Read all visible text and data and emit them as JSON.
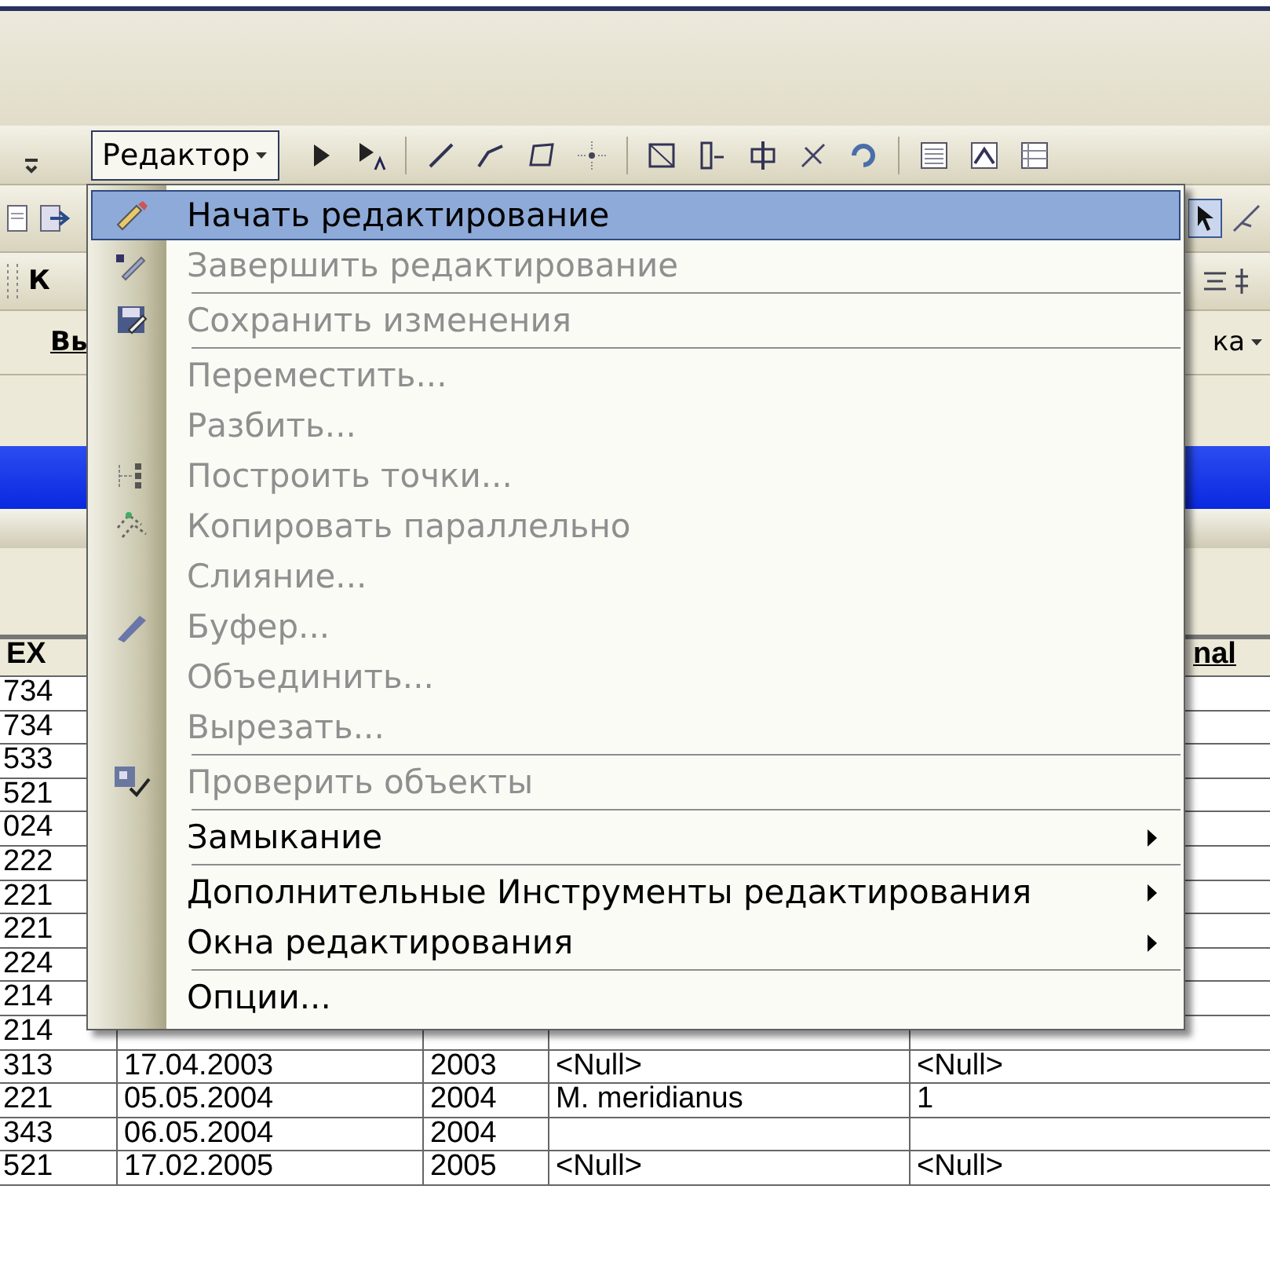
{
  "editor_toolbar": {
    "label": "Редактор"
  },
  "left_toolbar_fragments": [
    "К",
    "Вь"
  ],
  "right_toolbar_fragment": "ка",
  "table": {
    "header_left": "EX",
    "header_right": "nal",
    "rows": [
      {
        "cells": [
          "734"
        ]
      },
      {
        "cells": [
          "734"
        ]
      },
      {
        "cells": [
          "533"
        ]
      },
      {
        "cells": [
          "521"
        ]
      },
      {
        "cells": [
          "024"
        ]
      },
      {
        "cells": [
          "222"
        ]
      },
      {
        "cells": [
          "221"
        ]
      },
      {
        "cells": [
          "221"
        ]
      },
      {
        "cells": [
          "224"
        ]
      },
      {
        "cells": [
          "214"
        ]
      },
      {
        "cells": [
          "214"
        ]
      },
      {
        "cells": [
          "313",
          "17.04.2003",
          "2003",
          "<Null>",
          "<Null>"
        ]
      },
      {
        "cells": [
          "221",
          "05.05.2004",
          "2004",
          "M. meridianus",
          "1"
        ]
      },
      {
        "cells": [
          "343",
          "06.05.2004",
          "2004"
        ]
      },
      {
        "cells": [
          "521",
          "17.02.2005",
          "2005",
          "<Null>",
          "<Null>"
        ]
      }
    ]
  },
  "menu": {
    "items": [
      {
        "label": "Начать редактирование",
        "disabled": false,
        "highlighted": true,
        "submenu": false,
        "separator_after": false
      },
      {
        "label": "Завершить редактирование",
        "disabled": true,
        "highlighted": false,
        "submenu": false,
        "separator_after": true
      },
      {
        "label": "Сохранить изменения",
        "disabled": true,
        "highlighted": false,
        "submenu": false,
        "separator_after": true
      },
      {
        "label": "Переместить...",
        "disabled": true,
        "highlighted": false,
        "submenu": false,
        "separator_after": false
      },
      {
        "label": "Разбить...",
        "disabled": true,
        "highlighted": false,
        "submenu": false,
        "separator_after": false
      },
      {
        "label": "Построить точки...",
        "disabled": true,
        "highlighted": false,
        "submenu": false,
        "separator_after": false
      },
      {
        "label": "Копировать параллельно",
        "disabled": true,
        "highlighted": false,
        "submenu": false,
        "separator_after": false
      },
      {
        "label": "Слияние...",
        "disabled": true,
        "highlighted": false,
        "submenu": false,
        "separator_after": false
      },
      {
        "label": "Буфер...",
        "disabled": true,
        "highlighted": false,
        "submenu": false,
        "separator_after": false
      },
      {
        "label": "Объединить...",
        "disabled": true,
        "highlighted": false,
        "submenu": false,
        "separator_after": false
      },
      {
        "label": "Вырезать...",
        "disabled": true,
        "highlighted": false,
        "submenu": false,
        "separator_after": true
      },
      {
        "label": "Проверить объекты",
        "disabled": true,
        "highlighted": false,
        "submenu": false,
        "separator_after": true
      },
      {
        "label": "Замыкание",
        "disabled": false,
        "highlighted": false,
        "submenu": true,
        "separator_after": true
      },
      {
        "label": "Дополнительные Инструменты редактирования",
        "disabled": false,
        "highlighted": false,
        "submenu": true,
        "separator_after": false
      },
      {
        "label": "Окна редактирования",
        "disabled": false,
        "highlighted": false,
        "submenu": true,
        "separator_after": true
      },
      {
        "label": "Опции...",
        "disabled": false,
        "highlighted": false,
        "submenu": false,
        "separator_after": false
      }
    ]
  }
}
